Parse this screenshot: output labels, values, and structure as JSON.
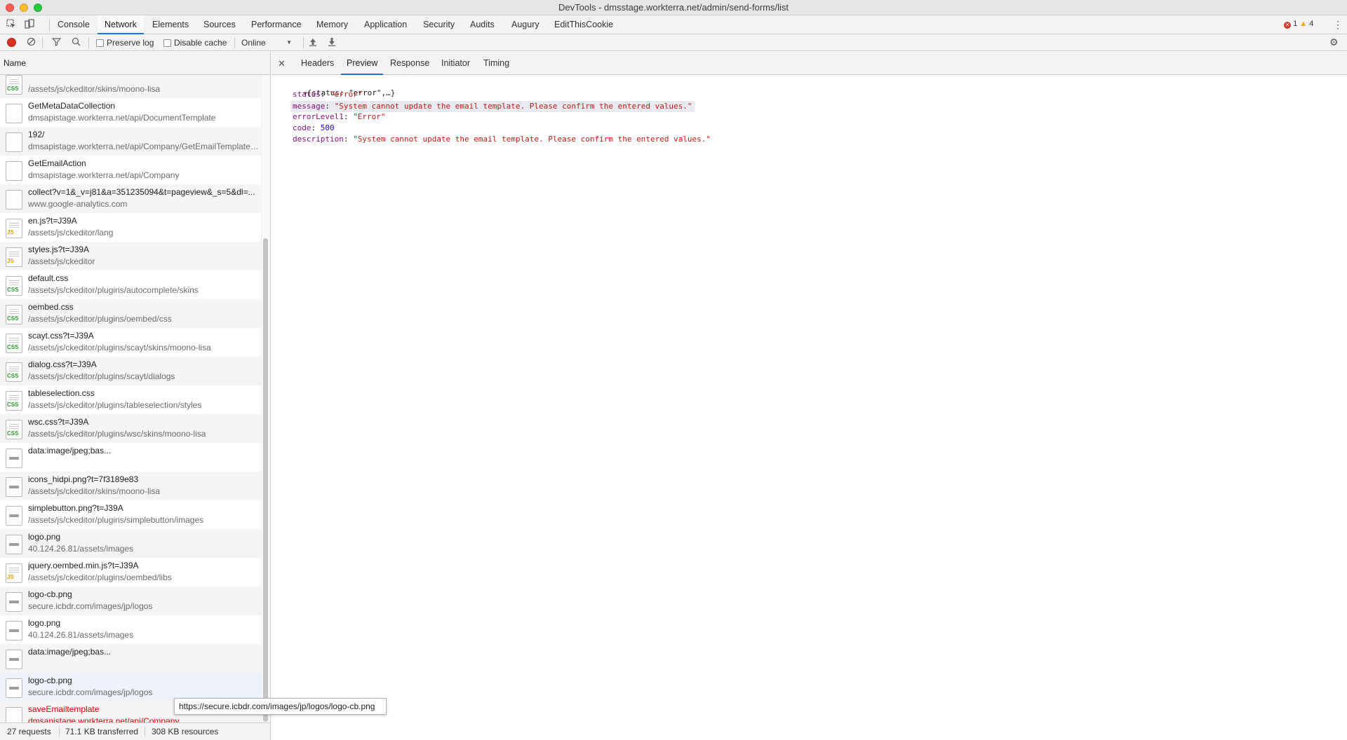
{
  "window": {
    "title": "DevTools - dmsstage.workterra.net/admin/send-forms/list"
  },
  "main_tabs": [
    {
      "label": "Console"
    },
    {
      "label": "Network"
    },
    {
      "label": "Elements"
    },
    {
      "label": "Sources"
    },
    {
      "label": "Performance"
    },
    {
      "label": "Memory"
    },
    {
      "label": "Application"
    },
    {
      "label": "Security"
    },
    {
      "label": "Audits"
    },
    {
      "label": "Augury"
    },
    {
      "label": "EditThisCookie"
    }
  ],
  "active_main_tab": "Network",
  "issues": {
    "errors": "1",
    "warnings": "4"
  },
  "toolbar": {
    "preserve_log": "Preserve log",
    "disable_cache": "Disable cache",
    "throttle": "Online"
  },
  "left": {
    "name_header": "Name",
    "requests": [
      {
        "name": "",
        "path": "/assets/js/ckeditor/skins/moono-lisa",
        "icon": "css-file-icon"
      },
      {
        "name": "GetMetaDataCollection",
        "path": "dmsapistage.workterra.net/api/DocumentTemplate",
        "icon": "document-icon"
      },
      {
        "name": "192/",
        "path": "dmsapistage.workterra.net/api/Company/GetEmailTemplate/...",
        "icon": "document-icon"
      },
      {
        "name": "GetEmailAction",
        "path": "dmsapistage.workterra.net/api/Company",
        "icon": "document-icon"
      },
      {
        "name": "collect?v=1&_v=j81&a=351235094&t=pageview&_s=5&dl=...",
        "path": "www.google-analytics.com",
        "icon": "document-icon"
      },
      {
        "name": "en.js?t=J39A",
        "path": "/assets/js/ckeditor/lang",
        "icon": "js-file-icon"
      },
      {
        "name": "styles.js?t=J39A",
        "path": "/assets/js/ckeditor",
        "icon": "js-file-icon"
      },
      {
        "name": "default.css",
        "path": "/assets/js/ckeditor/plugins/autocomplete/skins",
        "icon": "css-file-icon"
      },
      {
        "name": "oembed.css",
        "path": "/assets/js/ckeditor/plugins/oembed/css",
        "icon": "css-file-icon"
      },
      {
        "name": "scayt.css?t=J39A",
        "path": "/assets/js/ckeditor/plugins/scayt/skins/moono-lisa",
        "icon": "css-file-icon"
      },
      {
        "name": "dialog.css?t=J39A",
        "path": "/assets/js/ckeditor/plugins/scayt/dialogs",
        "icon": "css-file-icon"
      },
      {
        "name": "tableselection.css",
        "path": "/assets/js/ckeditor/plugins/tableselection/styles",
        "icon": "css-file-icon"
      },
      {
        "name": "wsc.css?t=J39A",
        "path": "/assets/js/ckeditor/plugins/wsc/skins/moono-lisa",
        "icon": "css-file-icon"
      },
      {
        "name": "data:image/jpeg;bas...",
        "path": "",
        "icon": "image-icon"
      },
      {
        "name": "icons_hidpi.png?t=7f3189e83",
        "path": "/assets/js/ckeditor/skins/moono-lisa",
        "icon": "image-icon"
      },
      {
        "name": "simplebutton.png?t=J39A",
        "path": "/assets/js/ckeditor/plugins/simplebutton/images",
        "icon": "image-icon"
      },
      {
        "name": "logo.png",
        "path": "40.124.26.81/assets/images",
        "icon": "image-icon"
      },
      {
        "name": "jquery.oembed.min.js?t=J39A",
        "path": "/assets/js/ckeditor/plugins/oembed/libs",
        "icon": "js-file-icon"
      },
      {
        "name": "logo-cb.png",
        "path": "secure.icbdr.com/images/jp/logos",
        "icon": "image-icon"
      },
      {
        "name": "logo.png",
        "path": "40.124.26.81/assets/images",
        "icon": "image-icon"
      },
      {
        "name": "data:image/jpeg;bas...",
        "path": "",
        "icon": "image-icon"
      },
      {
        "name": "logo-cb.png",
        "path": "secure.icbdr.com/images/jp/logos",
        "icon": "image-icon"
      },
      {
        "name": "saveEmailtemplate",
        "path": "dmsapistage.workterra.net/api/Company",
        "icon": "document-icon",
        "status": "error"
      }
    ],
    "tooltip": "https://secure.icbdr.com/images/jp/logos/logo-cb.png"
  },
  "status_bar": {
    "requests": "27 requests",
    "transferred": "71.1 KB transferred",
    "resources": "308 KB resources"
  },
  "detail": {
    "tabs": [
      {
        "label": "Headers"
      },
      {
        "label": "Preview"
      },
      {
        "label": "Response"
      },
      {
        "label": "Initiator"
      },
      {
        "label": "Timing"
      }
    ],
    "active_tab": "Preview",
    "preview": {
      "summary": "{status: \"error\",…}",
      "fields": [
        {
          "key": "status",
          "value": "\"error\"",
          "type": "string"
        },
        {
          "key": "message",
          "value": "\"System cannot update the email template. Please confirm the entered values.\"",
          "type": "string"
        },
        {
          "key": "errorLevel1",
          "value": "\"Error\"",
          "type": "string"
        },
        {
          "key": "code",
          "value": "500",
          "type": "number"
        },
        {
          "key": "description",
          "value": "\"System cannot update the email template. Please confirm the entered values.\"",
          "type": "string"
        }
      ]
    }
  }
}
